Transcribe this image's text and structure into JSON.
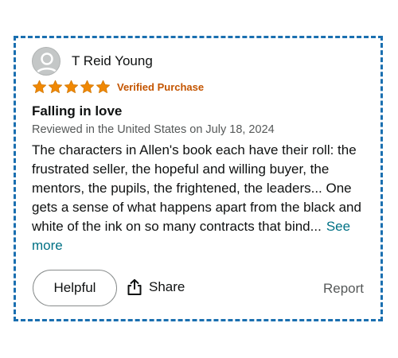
{
  "review": {
    "reviewer_name": "T Reid Young",
    "avatar_icon": "user-silhouette-icon",
    "rating": 5,
    "rating_max": 5,
    "star_color": "#f08804",
    "verified_label": "Verified Purchase",
    "title": "Falling in love",
    "date_text": "Reviewed in the United States on July 18, 2024",
    "body": "The characters in Allen's book each have their roll: the frustrated seller, the hopeful and willing buyer, the mentors, the pupils, the frightened, the leaders... One gets a sense of what happens apart from the black and white of the ink on so many contracts that bind...",
    "see_more_label": "See more"
  },
  "actions": {
    "helpful_label": "Helpful",
    "share_label": "Share",
    "share_icon": "share-icon",
    "report_label": "Report"
  },
  "colors": {
    "frame_border": "#1a6fb0",
    "link": "#007185",
    "verified": "#c45500"
  }
}
